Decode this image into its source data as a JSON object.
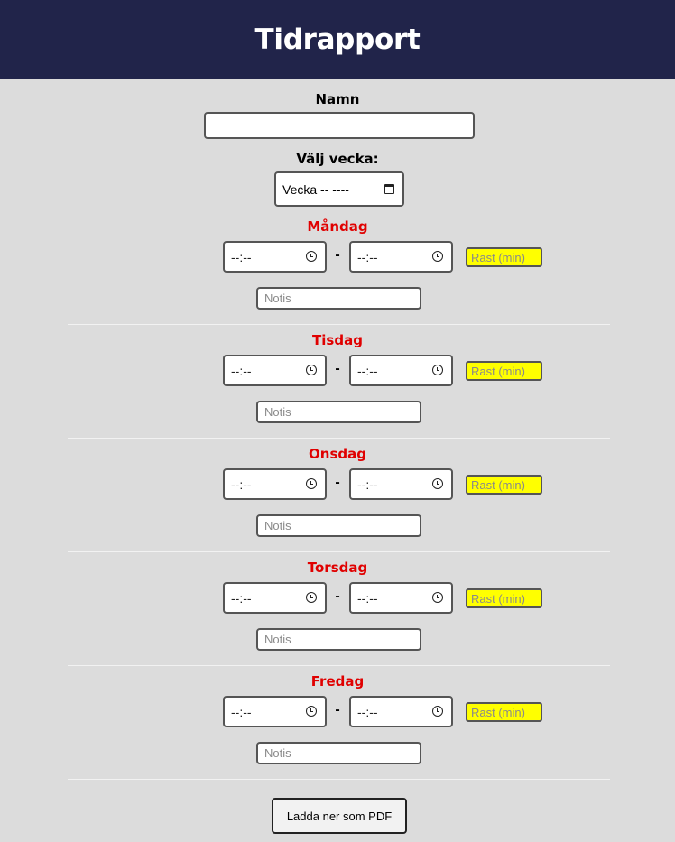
{
  "header": {
    "title": "Tidrapport"
  },
  "form": {
    "name_label": "Namn",
    "name_value": "",
    "week_label": "Välj vecka:",
    "week_placeholder": "Vecka -- ----"
  },
  "time_placeholder": "--:--",
  "separator": "-",
  "break_placeholder": "Rast (min)",
  "note_placeholder": "Notis",
  "days": [
    {
      "name": "Måndag"
    },
    {
      "name": "Tisdag"
    },
    {
      "name": "Onsdag"
    },
    {
      "name": "Torsdag"
    },
    {
      "name": "Fredag"
    }
  ],
  "download_button": "Ladda ner som PDF",
  "colors": {
    "header_bg": "#21244a",
    "page_bg": "#dcdcdc",
    "day_title": "#e00000",
    "break_field_bg": "#ffff00"
  }
}
